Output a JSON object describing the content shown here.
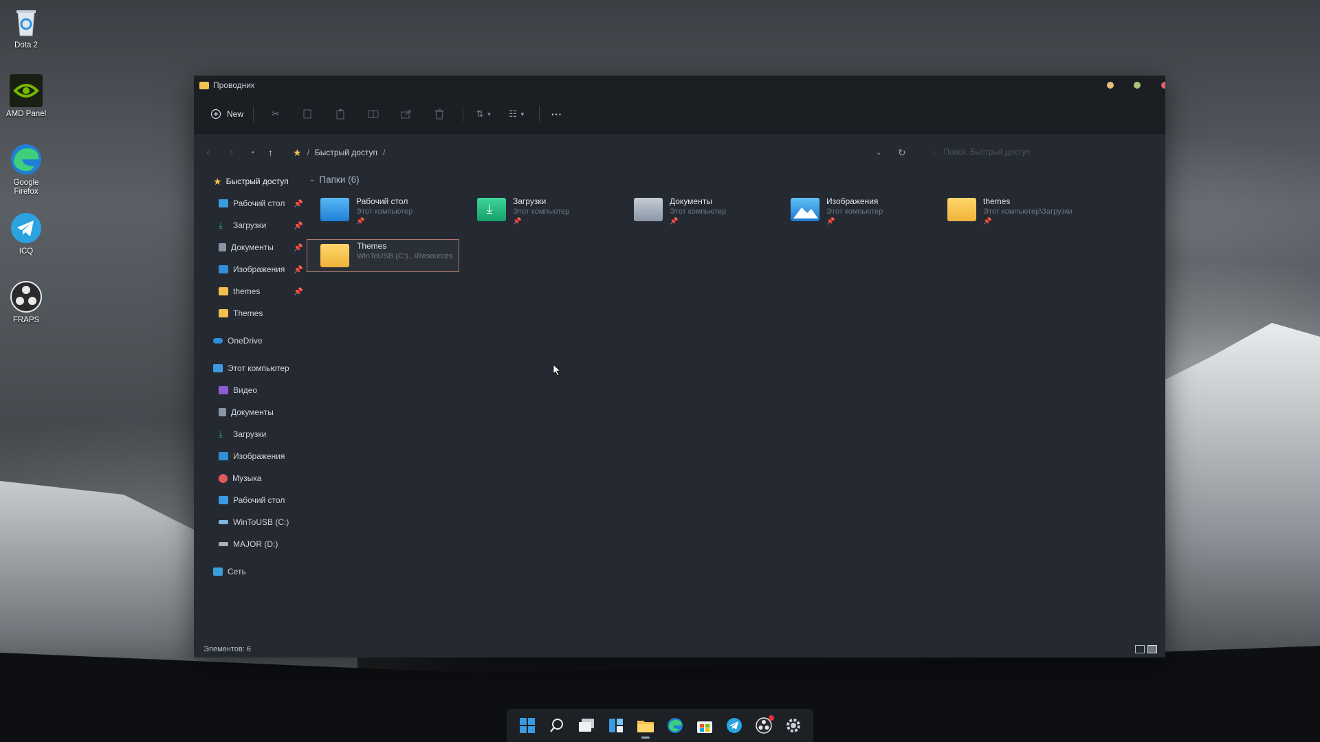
{
  "desktop": {
    "icons": [
      {
        "label": "Dota 2",
        "icon": "recycle-bin-icon"
      },
      {
        "label": "AMD Panel",
        "icon": "nvidia-icon"
      },
      {
        "label": "Google Firefox",
        "icon": "edge-icon"
      },
      {
        "label": "ICQ",
        "icon": "telegram-icon"
      },
      {
        "label": "FRAPS",
        "icon": "obs-icon"
      }
    ]
  },
  "window": {
    "title": "Проводник",
    "controls": {
      "minimize_color": "#e8c27a",
      "maximize_color": "#a8c47a",
      "close_color": "#e0626a"
    }
  },
  "toolbar": {
    "new_label": "New",
    "more_label": "···"
  },
  "address": {
    "path": [
      "Быстрый доступ"
    ],
    "separator": "/",
    "search_placeholder": "Поиск: Быстрый доступ"
  },
  "sidebar": {
    "quick_access": {
      "label": "Быстрый доступ",
      "items": [
        {
          "label": "Рабочий стол",
          "pinned": true,
          "icon": "desktop-icon",
          "color": "#3a9be0"
        },
        {
          "label": "Загрузки",
          "pinned": true,
          "icon": "download-icon",
          "color": "#2bb07a"
        },
        {
          "label": "Документы",
          "pinned": true,
          "icon": "document-icon",
          "color": "#8a95a5"
        },
        {
          "label": "Изображения",
          "pinned": true,
          "icon": "picture-icon",
          "color": "#2f8fd8"
        },
        {
          "label": "themes",
          "pinned": true,
          "icon": "folder-icon",
          "color": "#f2c14e"
        },
        {
          "label": "Themes",
          "pinned": false,
          "icon": "folder-icon",
          "color": "#f2c14e"
        }
      ]
    },
    "onedrive": {
      "label": "OneDrive"
    },
    "this_pc": {
      "label": "Этот компьютер",
      "items": [
        {
          "label": "Видео",
          "icon": "video-icon",
          "color": "#8e5bd6"
        },
        {
          "label": "Документы",
          "icon": "document-icon",
          "color": "#8a95a5"
        },
        {
          "label": "Загрузки",
          "icon": "download-icon",
          "color": "#2bb07a"
        },
        {
          "label": "Изображения",
          "icon": "picture-icon",
          "color": "#2f8fd8"
        },
        {
          "label": "Музыка",
          "icon": "music-icon",
          "color": "#e05a5a"
        },
        {
          "label": "Рабочий стол",
          "icon": "desktop-icon",
          "color": "#3a9be0"
        },
        {
          "label": "WinToUSB (C:)",
          "icon": "drive-icon",
          "color": "#7fb6e0"
        },
        {
          "label": "MAJOR (D:)",
          "icon": "drive-icon",
          "color": "#a9b0b8"
        }
      ]
    },
    "network": {
      "label": "Сеть"
    }
  },
  "content": {
    "group_label": "Папки (6)",
    "folders": [
      {
        "name": "Рабочий стол",
        "location": "Этот компьютер",
        "pinned": true,
        "icon": "desktop-folder-icon"
      },
      {
        "name": "Загрузки",
        "location": "Этот компьютер",
        "pinned": true,
        "icon": "downloads-folder-icon"
      },
      {
        "name": "Документы",
        "location": "Этот компьютер",
        "pinned": true,
        "icon": "documents-folder-icon"
      },
      {
        "name": "Изображения",
        "location": "Этот компьютер",
        "pinned": true,
        "icon": "pictures-folder-icon"
      },
      {
        "name": "themes",
        "location": "Этот компьютер\\Загрузки",
        "pinned": true,
        "icon": "folder-icon"
      },
      {
        "name": "Themes",
        "location": "WinToUSB (C:)...\\Resources",
        "pinned": false,
        "icon": "folder-icon",
        "selected": true
      }
    ]
  },
  "status": {
    "items_label": "Элементов: 6"
  },
  "taskbar": {
    "icons": [
      "start-icon",
      "search-icon",
      "task-view-icon",
      "widgets-icon",
      "file-explorer-icon",
      "edge-icon",
      "store-icon",
      "telegram-icon",
      "obs-icon",
      "settings-icon"
    ]
  }
}
